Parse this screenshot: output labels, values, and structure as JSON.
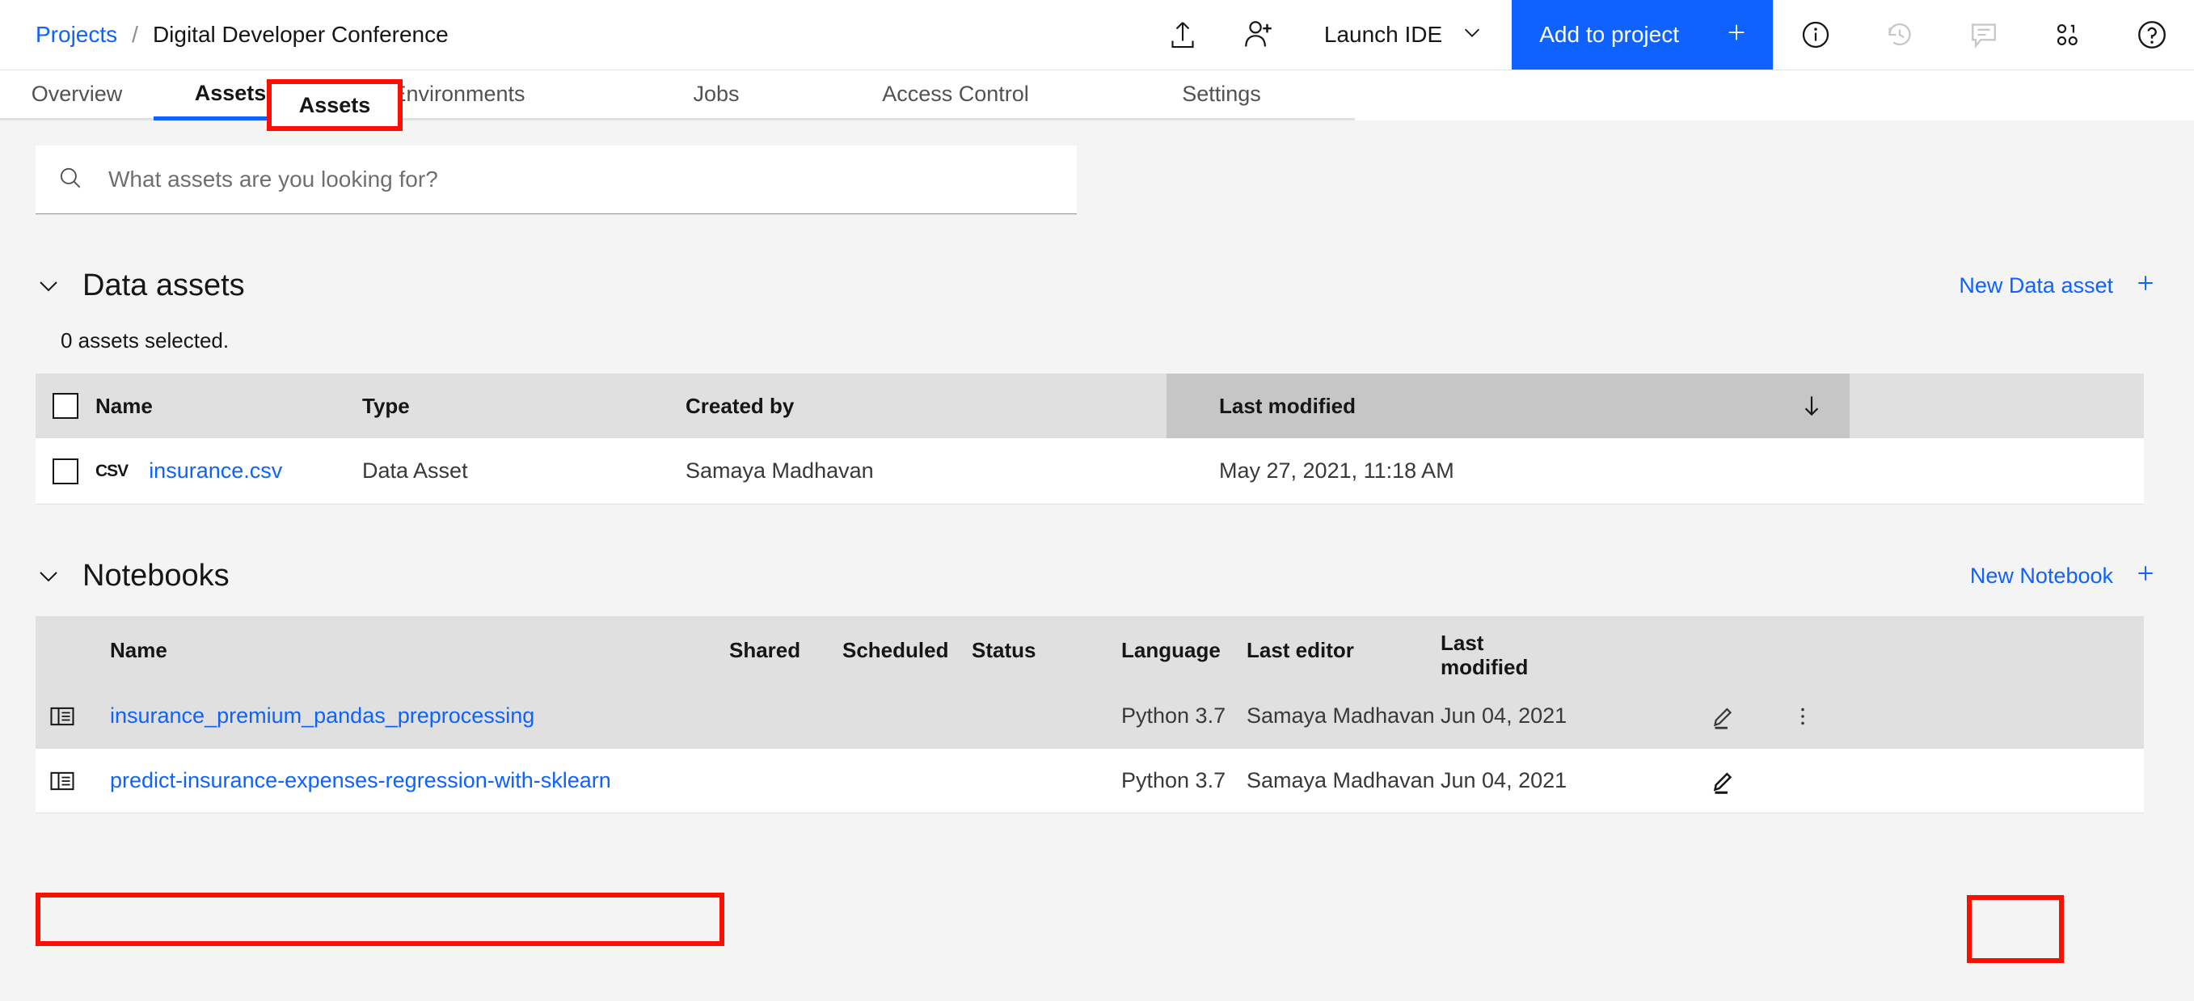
{
  "breadcrumb": {
    "root": "Projects",
    "separator": "/",
    "current": "Digital Developer Conference"
  },
  "topbar": {
    "upload_icon": "upload-icon",
    "add_collaborator_icon": "add-user-icon",
    "launch_ide_label": "Launch IDE",
    "launch_ide_chevron": "chevron-down-icon",
    "add_to_project_label": "Add to project",
    "add_to_project_plus": "plus-icon",
    "right_icons": [
      "info-icon",
      "history-icon",
      "comment-icon",
      "data-binary-icon",
      "help-icon"
    ],
    "accent_color": "#0f62fe"
  },
  "tabs": [
    {
      "label": "Overview",
      "active": false
    },
    {
      "label": "Assets",
      "active": true
    },
    {
      "label": "Environments",
      "active": false
    },
    {
      "label": "Jobs",
      "active": false
    },
    {
      "label": "Access Control",
      "active": false
    },
    {
      "label": "Settings",
      "active": false
    }
  ],
  "search": {
    "placeholder": "What assets are you looking for?",
    "value": "",
    "icon": "search-icon"
  },
  "data_assets": {
    "title": "Data assets",
    "chevron": "chevron-down-icon",
    "new_label": "New Data asset",
    "new_plus": "+",
    "selected_note": "0 assets selected.",
    "columns": [
      "Name",
      "Type",
      "Created by",
      "Last modified"
    ],
    "sorted_column": "Last modified",
    "sort_direction": "descending",
    "sort_icon": "arrow-down-icon",
    "rows": [
      {
        "name": "insurance.csv",
        "file_type_badge": "CSV",
        "type": "Data Asset",
        "created_by": "Samaya Madhavan",
        "last_modified": "May 27, 2021, 11:18 AM",
        "checked": false
      }
    ]
  },
  "notebooks": {
    "title": "Notebooks",
    "chevron": "chevron-down-icon",
    "new_label": "New Notebook",
    "new_plus": "+",
    "columns": {
      "name": "Name",
      "shared": "Shared",
      "scheduled": "Scheduled",
      "status": "Status",
      "language": "Language",
      "last_editor": "Last editor",
      "last_modified_line1": "Last",
      "last_modified_line2": "modified"
    },
    "rows": [
      {
        "icon": "notebook-icon",
        "name": "insurance_premium_pandas_preprocessing",
        "shared": "",
        "scheduled": "",
        "status": "",
        "language": "Python 3.7",
        "last_editor": "Samaya Madhavan",
        "last_modified": "Jun 04, 2021",
        "edit_icon": "pencil-icon",
        "overflow_icon": "overflow-menu-icon",
        "hovered": true,
        "highlighted": false
      },
      {
        "icon": "notebook-icon",
        "name": "predict-insurance-expenses-regression-with-sklearn",
        "shared": "",
        "scheduled": "",
        "status": "",
        "language": "Python 3.7",
        "last_editor": "Samaya Madhavan",
        "last_modified": "Jun 04, 2021",
        "edit_icon": "pencil-icon",
        "overflow_icon": "",
        "hovered": false,
        "highlighted": true
      }
    ]
  },
  "annotations": {
    "color": "#fa0f00",
    "targets": [
      "tab-assets",
      "notebook-name-predict-insurance-expenses-regression-with-sklearn",
      "notebook-edit-pencil-row-2"
    ]
  }
}
